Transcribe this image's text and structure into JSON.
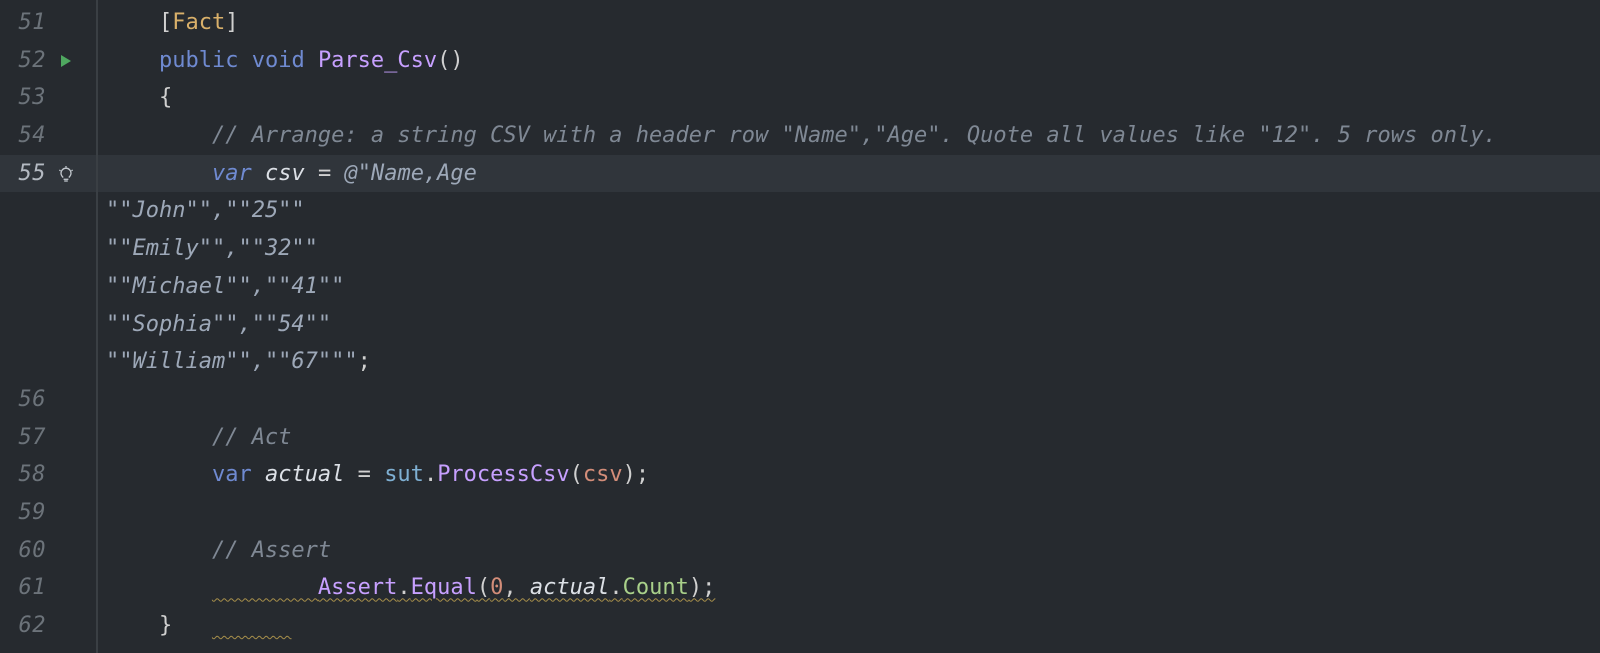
{
  "gutter": {
    "numbers": [
      "51",
      "52",
      "53",
      "54",
      "55",
      "",
      "",
      "",
      "",
      "",
      "56",
      "57",
      "58",
      "59",
      "60",
      "61",
      "62"
    ],
    "run_icon_line": "52",
    "bulb_icon_line": "55",
    "active_line": "55"
  },
  "code": {
    "l51": {
      "lb": "[",
      "attr": "Fact",
      "rb": "]"
    },
    "l52": {
      "kw1": "public",
      "kw2": "void",
      "method": "Parse_Csv",
      "paren": "()"
    },
    "l53": {
      "brace": "{"
    },
    "l54": {
      "cmt": "// Arrange: a string CSV with a header row \"Name\",\"Age\". Quote all values like \"12\". 5 rows only."
    },
    "l55": {
      "kw": "var",
      "name": "csv",
      "eq": " = ",
      "at": "@",
      "qt": "\"",
      "str": "Name,Age"
    },
    "s1": "\"\"John\"\",\"\"25\"\"",
    "s2": "\"\"Emily\"\",\"\"32\"\"",
    "s3": "\"\"Michael\"\",\"\"41\"\"",
    "s4": "\"\"Sophia\"\",\"\"54\"\"",
    "s5_a": "\"\"William\"\",\"\"67\"\"\"",
    "s5_b": ";",
    "l57": {
      "cmt": "// Act"
    },
    "l58": {
      "kw": "var",
      "name": "actual",
      "eq": " = ",
      "obj": "sut",
      "dot": ".",
      "call": "ProcessCsv",
      "lp": "(",
      "arg": "csv",
      "rp": ");"
    },
    "l60": {
      "cmt": "// Assert"
    },
    "l61": {
      "cls": "Assert",
      "dot": ".",
      "call": "Equal",
      "lp": "(",
      "n": "0",
      "c": ", ",
      "a": "actual",
      "dot2": ".",
      "prop": "Count",
      "rp": ");"
    },
    "l62": {
      "brace": "}"
    }
  }
}
